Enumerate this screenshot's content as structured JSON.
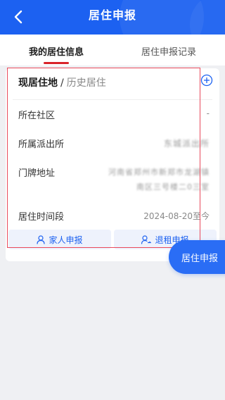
{
  "header": {
    "title": "居住申报",
    "back_icon": "chevron-left-icon"
  },
  "tabs": [
    {
      "label": "我的居住信息",
      "active": true
    },
    {
      "label": "居住申报记录",
      "active": false
    }
  ],
  "card": {
    "current_label": "现居住地",
    "separator": "/",
    "history_label": "历史居住",
    "rows": {
      "community": {
        "label": "所在社区",
        "value": "-"
      },
      "police_station": {
        "label": "所属派出所",
        "value": "东城派出所"
      },
      "address": {
        "label": "门牌地址",
        "value_line1": "河南省郑州市新郑市龙湖镇",
        "value_line2": "南区三号楼二0三室"
      },
      "period": {
        "label": "居住时间段",
        "value": "2024-08-20至今"
      }
    },
    "actions": {
      "family": {
        "label": "家人申报",
        "icon": "person-icon"
      },
      "checkout": {
        "label": "退租申报",
        "icon": "person-arrow-icon"
      }
    }
  },
  "fab": {
    "label": "居住申报"
  },
  "colors": {
    "primary": "#1c61f1",
    "accent_red": "#d9232a"
  }
}
